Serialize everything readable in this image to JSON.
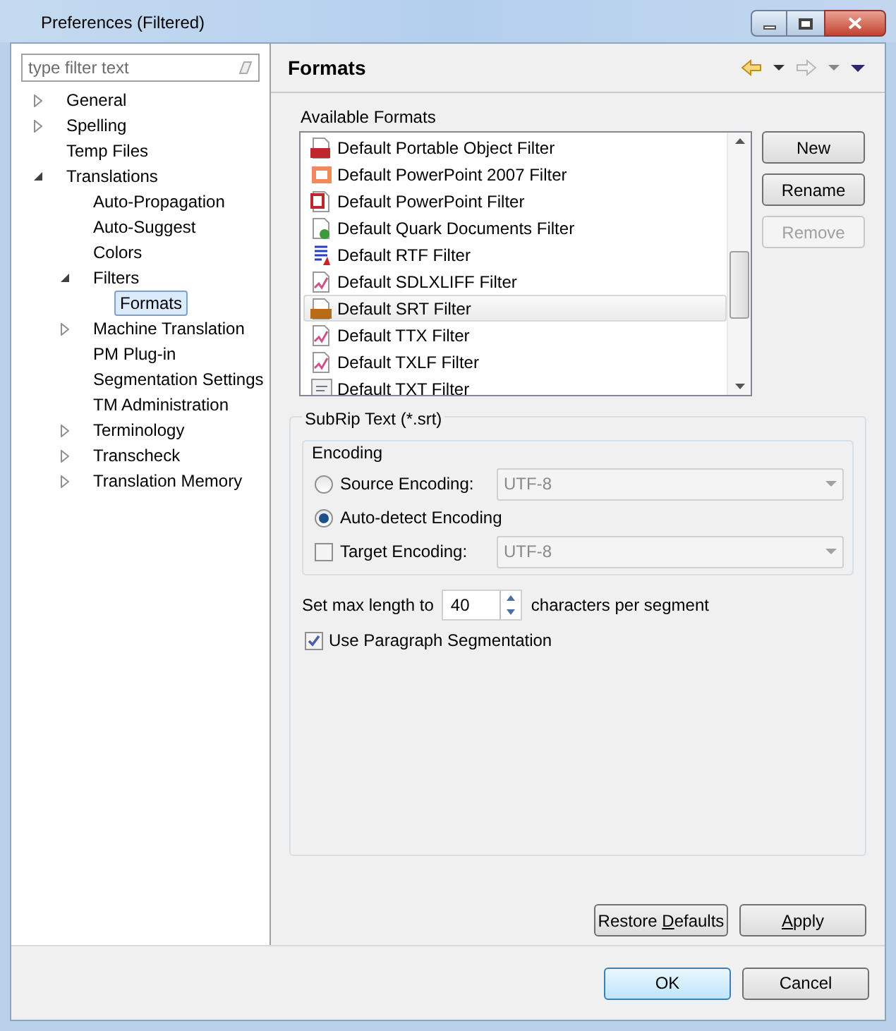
{
  "window": {
    "title": "Preferences (Filtered)"
  },
  "filter": {
    "placeholder": "type filter text"
  },
  "tree": [
    {
      "label": "General",
      "expanded": false,
      "selected": false
    },
    {
      "label": "Spelling",
      "expanded": false,
      "selected": false
    },
    {
      "label": "Temp Files",
      "selected": false
    },
    {
      "label": "Translations",
      "expanded": true,
      "selected": false,
      "children": [
        {
          "label": "Auto-Propagation",
          "selected": false
        },
        {
          "label": "Auto-Suggest",
          "selected": false
        },
        {
          "label": "Colors",
          "selected": false
        },
        {
          "label": "Filters",
          "expanded": true,
          "selected": false,
          "children": [
            {
              "label": "Formats",
              "selected": true
            }
          ]
        },
        {
          "label": "Machine Translation",
          "expanded": false,
          "selected": false
        },
        {
          "label": "PM Plug-in",
          "selected": false
        },
        {
          "label": "Segmentation Settings",
          "selected": false
        },
        {
          "label": "TM Administration",
          "selected": false
        },
        {
          "label": "Terminology",
          "expanded": false,
          "selected": false
        },
        {
          "label": "Transcheck",
          "expanded": false,
          "selected": false
        },
        {
          "label": "Translation Memory",
          "expanded": false,
          "selected": false
        }
      ]
    }
  ],
  "page": {
    "title": "Formats",
    "back_enabled": true,
    "forward_enabled": false
  },
  "formats": {
    "label": "Available Formats",
    "items": [
      {
        "label": "Default Portable Object Filter",
        "kind": "po",
        "selected": false
      },
      {
        "label": "Default PowerPoint 2007 Filter",
        "kind": "pptx",
        "selected": false
      },
      {
        "label": "Default PowerPoint Filter",
        "kind": "ppt",
        "selected": false
      },
      {
        "label": "Default Quark Documents Filter",
        "kind": "quark",
        "selected": false
      },
      {
        "label": "Default RTF Filter",
        "kind": "rtf",
        "selected": false
      },
      {
        "label": "Default SDLXLIFF Filter",
        "kind": "xliff",
        "selected": false
      },
      {
        "label": "Default SRT Filter",
        "kind": "srt",
        "selected": true
      },
      {
        "label": "Default TTX Filter",
        "kind": "xliff",
        "selected": false
      },
      {
        "label": "Default TXLF Filter",
        "kind": "xliff",
        "selected": false
      },
      {
        "label": "Default TXT Filter",
        "kind": "txt",
        "selected": false
      }
    ],
    "buttons": [
      {
        "label": "New",
        "disabled": false
      },
      {
        "label": "Rename",
        "disabled": false
      },
      {
        "label": "Remove",
        "disabled": true
      }
    ]
  },
  "settings": {
    "label": "SubRip Text (*.srt)",
    "encoding": {
      "label": "Encoding",
      "rows": [
        {
          "kind": "radio",
          "label": "Source Encoding:",
          "checked": false,
          "value": "UTF-8"
        },
        {
          "kind": "radio",
          "label": "Auto-detect Encoding",
          "checked": true
        },
        {
          "kind": "checkbox",
          "label": "Target Encoding:",
          "checked": false,
          "value": "UTF-8"
        }
      ]
    },
    "max_length": {
      "label": "Set max length to",
      "value": "40",
      "suffix": "characters per segment"
    },
    "paragraph": {
      "label": "Use Paragraph Segmentation",
      "checked": true
    }
  },
  "page_buttons": [
    {
      "before": "Restore ",
      "access_key": "D",
      "after": "efaults"
    },
    {
      "access_key": "A",
      "after": "pply"
    }
  ],
  "dialog_buttons": [
    {
      "label": "OK",
      "default": true
    },
    {
      "label": "Cancel",
      "default": false
    }
  ]
}
